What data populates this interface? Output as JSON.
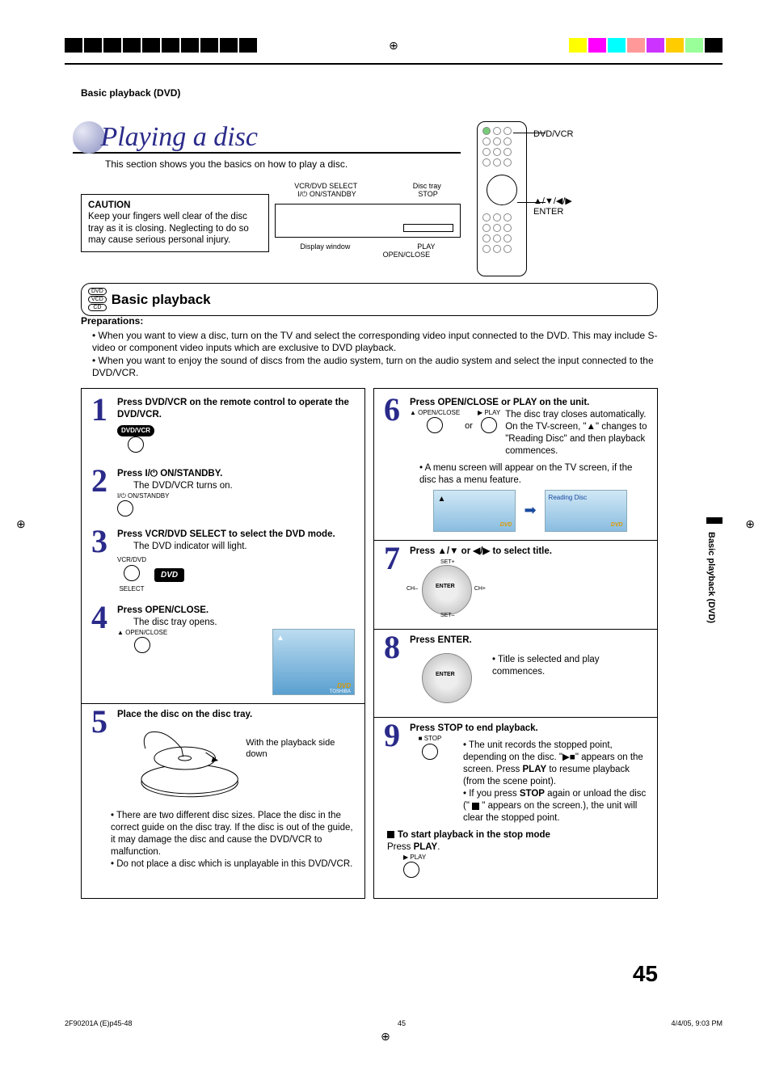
{
  "breadcrumb": "Basic playback (DVD)",
  "title": "Playing a disc",
  "subtitle": "This section shows you the basics on how to play a disc.",
  "caution": {
    "heading": "CAUTION",
    "body": "Keep your fingers well clear of the disc tray as it is closing. Neglecting to do so may cause serious personal injury."
  },
  "device_labels": {
    "onstandby": "I/⏻ ON/STANDBY",
    "vcrdvd": "VCR/DVD SELECT",
    "disctray": "Disc tray",
    "stop": "STOP",
    "display": "Display window",
    "play": "PLAY",
    "openclose": "OPEN/CLOSE"
  },
  "remote_labels": {
    "dvdvcr": "DVD/VCR",
    "nav": "▲/▼/◀/▶",
    "enter": "ENTER"
  },
  "section": {
    "badges": [
      "DVD",
      "VCD",
      "CD"
    ],
    "title": "Basic playback"
  },
  "preparations": {
    "title": "Preparations:",
    "items": [
      "When you want to view a disc, turn on the TV and select the corresponding video input connected to the DVD. This may include S-video or component video inputs which are exclusive to DVD playback.",
      "When you want to enjoy the sound of discs from the audio system, turn on the audio system and select the input connected to the DVD/VCR."
    ]
  },
  "steps": {
    "s1": {
      "title": "Press DVD/VCR on the remote control to operate the DVD/VCR.",
      "pill": "DVD/VCR"
    },
    "s2": {
      "title_a": "Press ",
      "title_b": " ON/STANDBY.",
      "onstandby_sym": "I/⏻",
      "sub": "The DVD/VCR turns on.",
      "label": "I/⏻ ON/STANDBY"
    },
    "s3": {
      "title": "Press VCR/DVD SELECT to select the DVD mode.",
      "sub": "The DVD indicator will light.",
      "vcrdvd": "VCR/DVD",
      "select": "SELECT",
      "dvd": "DVD"
    },
    "s4": {
      "title": "Press OPEN/CLOSE.",
      "sub": "The disc tray opens.",
      "oc_label": "▲ OPEN/CLOSE",
      "eject": "▲",
      "dvd_logo": "DVD",
      "brand": "TOSHIBA"
    },
    "s5": {
      "title": "Place the disc on the disc tray.",
      "side_down": "With the playback side down",
      "bullets": [
        "There are two different disc sizes. Place the disc in the correct guide on the disc tray. If the disc is out of the guide, it may damage the disc and cause the DVD/VCR to malfunction.",
        "Do not place a disc which is unplayable in this DVD/VCR."
      ]
    },
    "s6": {
      "title": "Press OPEN/CLOSE or PLAY on the unit.",
      "oc_label": "▲ OPEN/CLOSE",
      "play_label": "▶ PLAY",
      "or": "or",
      "body": "The disc tray closes automatically. On the TV-screen, \"▲\" changes to \"Reading Disc\" and then playback commences.",
      "bullet": "A menu screen will appear on the TV screen, if the disc has a menu feature.",
      "tv_eject": "▲",
      "tv_reading": "Reading Disc",
      "tv_dvd": "DVD"
    },
    "s7": {
      "title": "Press ▲/▼ or ◀/▶ to select title.",
      "enter": "ENTER",
      "chplus": "CH+",
      "chminus": "CH–",
      "set_plus": "SET+",
      "set_minus": "SET–"
    },
    "s8": {
      "title": "Press ENTER.",
      "bullet": "Title is selected and play commences.",
      "enter": "ENTER"
    },
    "s9": {
      "title": "Press STOP to end playback.",
      "stop_label": "■ STOP",
      "b1a": "The unit records the stopped point, depending on the disc. \"",
      "b1_icon": "▶■",
      "b1b": "\" appears on the screen. Press ",
      "b1_play": "PLAY",
      "b1c": " to resume playback (from the scene point).",
      "b2a": "If you press ",
      "b2_stop": "STOP",
      "b2b": " again or unload the disc (\" ",
      "b2c": " \" appears on the screen.), the unit will clear the stopped point."
    },
    "start": {
      "title": "To start playback in the stop mode",
      "press": "Press ",
      "play": "PLAY",
      "dot": ".",
      "label": "▶ PLAY"
    }
  },
  "page_number": "45",
  "side_tab": "Basic playback (DVD)",
  "footer": {
    "left": "2F90201A (E)p45-48",
    "center": "45",
    "right": "4/4/05, 9:03 PM"
  }
}
